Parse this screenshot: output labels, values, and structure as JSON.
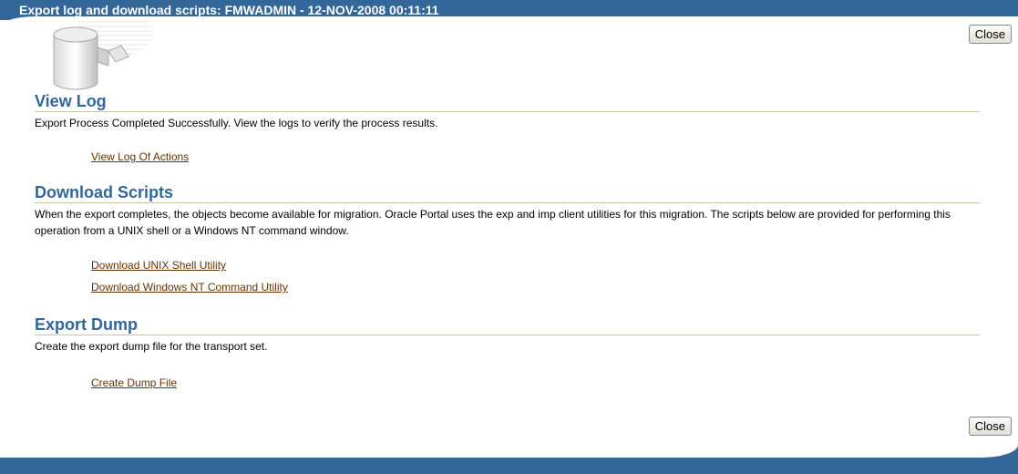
{
  "window": {
    "title": "Export log and download scripts: FMWADMIN - 12-NOV-2008 00:11:11"
  },
  "buttons": {
    "close_top": "Close",
    "close_bottom": "Close"
  },
  "view_log": {
    "heading": "View Log",
    "description": "Export Process Completed Successfully. View the logs to verify the process results.",
    "link": "View Log Of Actions"
  },
  "download_scripts": {
    "heading": "Download Scripts",
    "description": "When the export completes, the objects become available for migration. Oracle Portal uses the exp and imp client utilities for this migration. The scripts below are provided for performing this operation from a UNIX shell or a Windows NT command window.",
    "links": [
      "Download UNIX Shell Utility",
      "Download Windows NT Command Utility"
    ]
  },
  "export_dump": {
    "heading": "Export Dump",
    "description": "Create the export dump file for the transport set.",
    "link": "Create Dump File"
  },
  "colors": {
    "brand": "#336699",
    "link": "#663300",
    "rule": "#c9c6a8"
  },
  "icons": {
    "logo": "database-icon"
  }
}
